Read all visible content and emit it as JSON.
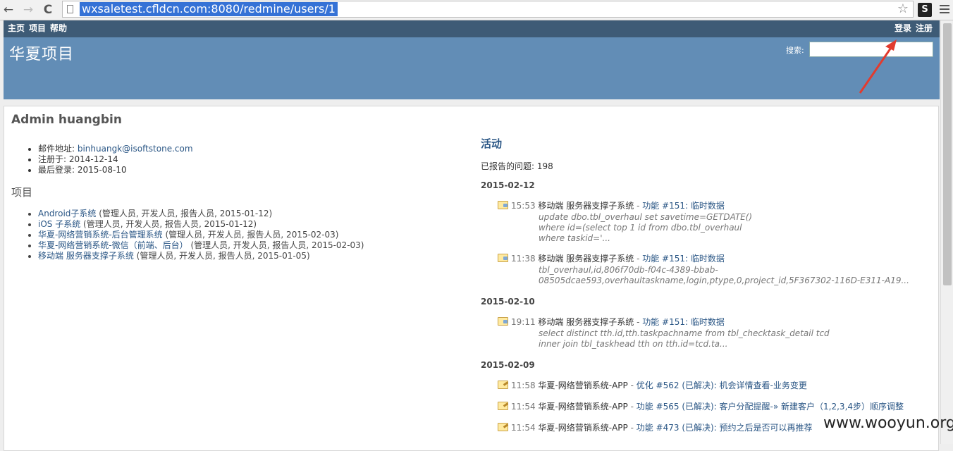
{
  "browser": {
    "back_icon": "←",
    "forward_icon": "→",
    "reload_icon": "C",
    "url": "wxsaletest.cfldcn.com:8080/redmine/users/1",
    "star_icon": "☆",
    "extension_label": "S"
  },
  "topmenu": {
    "left": [
      "主页",
      "项目",
      "帮助"
    ],
    "right": [
      "登录",
      "注册"
    ]
  },
  "header": {
    "project_title": "华夏项目",
    "search_label": "搜索:",
    "search_value": ""
  },
  "user": {
    "name": "Admin huangbin",
    "email_label": "邮件地址: ",
    "email": "binhuangk@isoftstone.com",
    "registered": "注册于: 2014-12-14",
    "last_login": "最后登录: 2015-08-10"
  },
  "projects": {
    "heading": "项目",
    "items": [
      {
        "name": "Android子系统",
        "roles": " (管理人员, 开发人员, 报告人员, 2015-01-12)"
      },
      {
        "name": "iOS 子系统",
        "roles": " (管理人员, 开发人员, 报告人员, 2015-01-12)"
      },
      {
        "name": "华夏-网络营销系统-后台管理系统",
        "roles": " (管理人员, 开发人员, 报告人员, 2015-02-03)"
      },
      {
        "name": "华夏-网络营销系统-微信（前端、后台）",
        "roles": " (管理人员, 开发人员, 报告人员, 2015-02-03)"
      },
      {
        "name": "移动端 服务器支撑子系统",
        "roles": " (管理人员, 开发人员, 报告人员, 2015-01-05)"
      }
    ]
  },
  "activity": {
    "heading": "活动",
    "reported_label": "已报告的问题: ",
    "reported_count": "198",
    "dates": [
      {
        "date": "2015-02-12",
        "events": [
          {
            "time": "15:53",
            "project": "移动端 服务器支撑子系统",
            "sep": " - ",
            "link": "功能 #151: 临时数据",
            "desc": "update dbo.tbl_overhaul set savetime=GETDATE()\nwhere id=(select top 1 id from dbo.tbl_overhaul\nwhere taskid='..."
          },
          {
            "time": "11:38",
            "project": "移动端 服务器支撑子系统",
            "sep": " - ",
            "link": "功能 #151: 临时数据",
            "desc": "tbl_overhaul,id,806f70db-f04c-4389-bbab-\n08505dcae593,overhaultaskname,login,ptype,0,project_id,5F367302-116D-E311-A19..."
          }
        ]
      },
      {
        "date": "2015-02-10",
        "events": [
          {
            "time": "19:11",
            "project": "移动端 服务器支撑子系统",
            "sep": " - ",
            "link": "功能 #151: 临时数据",
            "desc": "select distinct tth.id,tth.taskpachname from tbl_checktask_detail tcd\ninner join tbl_taskhead tth on tth.id=tcd.ta..."
          }
        ]
      },
      {
        "date": "2015-02-09",
        "events": [
          {
            "time": "11:58",
            "project": "华夏-网络营销系统-APP",
            "sep": " - ",
            "link": "优化 #562 (已解决): 机会详情查看-业务变更",
            "desc": ""
          },
          {
            "time": "11:54",
            "project": "华夏-网络营销系统-APP",
            "sep": " - ",
            "link": "功能 #565 (已解决): 客户分配提醒-» 新建客户（1,2,3,4步）顺序调整",
            "desc": ""
          },
          {
            "time": "11:54",
            "project": "华夏-网络营销系统-APP",
            "sep": " - ",
            "link": "功能 #473 (已解决): 预约之后是否可以再推荐",
            "desc": ""
          }
        ]
      }
    ]
  },
  "watermark": "www.wooyun.org",
  "colors": {
    "topmenu_bg": "#3e5b76",
    "header_bg": "#628db6",
    "link": "#2a5685",
    "annotation_arrow": "#e23b2e"
  }
}
